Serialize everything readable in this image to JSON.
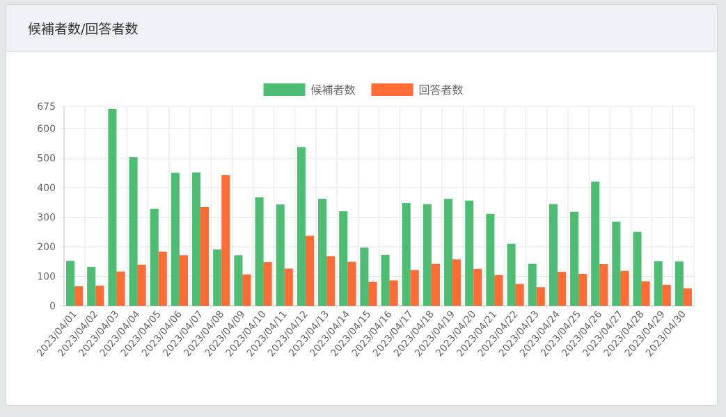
{
  "card": {
    "title": "候補者数/回答者数"
  },
  "chart_data": {
    "type": "bar",
    "title": "",
    "xlabel": "",
    "ylabel": "",
    "ylim": [
      0,
      675
    ],
    "yticks": [
      0,
      100,
      200,
      300,
      400,
      500,
      600,
      675
    ],
    "grid": true,
    "legend_position": "top",
    "categories": [
      "2023/04/01",
      "2023/04/02",
      "2023/04/03",
      "2023/04/04",
      "2023/04/05",
      "2023/04/06",
      "2023/04/07",
      "2023/04/08",
      "2023/04/09",
      "2023/04/10",
      "2023/04/11",
      "2023/04/12",
      "2023/04/13",
      "2023/04/14",
      "2023/04/15",
      "2023/04/16",
      "2023/04/17",
      "2023/04/18",
      "2023/04/19",
      "2023/04/20",
      "2023/04/21",
      "2023/04/22",
      "2023/04/23",
      "2023/04/24",
      "2023/04/25",
      "2023/04/26",
      "2023/04/27",
      "2023/04/28",
      "2023/04/29",
      "2023/04/30"
    ],
    "series": [
      {
        "name": "候補者数",
        "color": "#4dbd74",
        "values": [
          152,
          132,
          666,
          503,
          328,
          450,
          451,
          191,
          171,
          367,
          343,
          537,
          362,
          320,
          197,
          172,
          348,
          344,
          362,
          356,
          311,
          210,
          142,
          344,
          318,
          420,
          285,
          250,
          151,
          150
        ]
      },
      {
        "name": "回答者数",
        "color": "#ff6b35",
        "values": [
          66,
          68,
          116,
          139,
          183,
          171,
          334,
          442,
          106,
          148,
          126,
          237,
          168,
          149,
          81,
          86,
          121,
          142,
          157,
          125,
          104,
          74,
          63,
          115,
          108,
          141,
          118,
          83,
          71,
          59
        ]
      }
    ]
  }
}
